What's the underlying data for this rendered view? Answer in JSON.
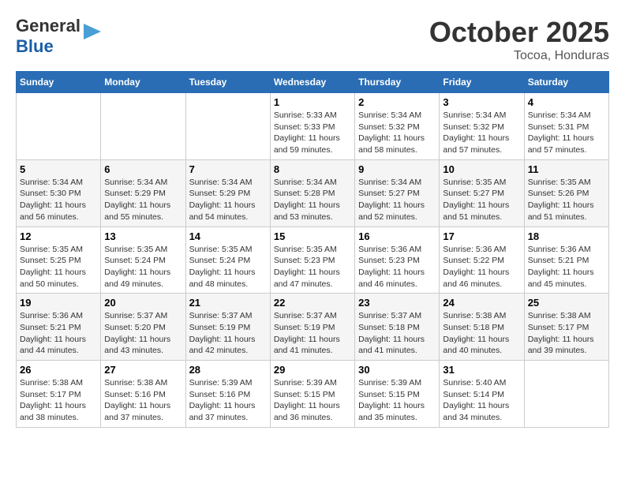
{
  "logo": {
    "line1": "General",
    "line2": "Blue"
  },
  "title": "October 2025",
  "location": "Tocoa, Honduras",
  "weekdays": [
    "Sunday",
    "Monday",
    "Tuesday",
    "Wednesday",
    "Thursday",
    "Friday",
    "Saturday"
  ],
  "weeks": [
    [
      {
        "day": "",
        "sunrise": "",
        "sunset": "",
        "daylight": ""
      },
      {
        "day": "",
        "sunrise": "",
        "sunset": "",
        "daylight": ""
      },
      {
        "day": "",
        "sunrise": "",
        "sunset": "",
        "daylight": ""
      },
      {
        "day": "1",
        "sunrise": "Sunrise: 5:33 AM",
        "sunset": "Sunset: 5:33 PM",
        "daylight": "Daylight: 11 hours and 59 minutes."
      },
      {
        "day": "2",
        "sunrise": "Sunrise: 5:34 AM",
        "sunset": "Sunset: 5:32 PM",
        "daylight": "Daylight: 11 hours and 58 minutes."
      },
      {
        "day": "3",
        "sunrise": "Sunrise: 5:34 AM",
        "sunset": "Sunset: 5:32 PM",
        "daylight": "Daylight: 11 hours and 57 minutes."
      },
      {
        "day": "4",
        "sunrise": "Sunrise: 5:34 AM",
        "sunset": "Sunset: 5:31 PM",
        "daylight": "Daylight: 11 hours and 57 minutes."
      }
    ],
    [
      {
        "day": "5",
        "sunrise": "Sunrise: 5:34 AM",
        "sunset": "Sunset: 5:30 PM",
        "daylight": "Daylight: 11 hours and 56 minutes."
      },
      {
        "day": "6",
        "sunrise": "Sunrise: 5:34 AM",
        "sunset": "Sunset: 5:29 PM",
        "daylight": "Daylight: 11 hours and 55 minutes."
      },
      {
        "day": "7",
        "sunrise": "Sunrise: 5:34 AM",
        "sunset": "Sunset: 5:29 PM",
        "daylight": "Daylight: 11 hours and 54 minutes."
      },
      {
        "day": "8",
        "sunrise": "Sunrise: 5:34 AM",
        "sunset": "Sunset: 5:28 PM",
        "daylight": "Daylight: 11 hours and 53 minutes."
      },
      {
        "day": "9",
        "sunrise": "Sunrise: 5:34 AM",
        "sunset": "Sunset: 5:27 PM",
        "daylight": "Daylight: 11 hours and 52 minutes."
      },
      {
        "day": "10",
        "sunrise": "Sunrise: 5:35 AM",
        "sunset": "Sunset: 5:27 PM",
        "daylight": "Daylight: 11 hours and 51 minutes."
      },
      {
        "day": "11",
        "sunrise": "Sunrise: 5:35 AM",
        "sunset": "Sunset: 5:26 PM",
        "daylight": "Daylight: 11 hours and 51 minutes."
      }
    ],
    [
      {
        "day": "12",
        "sunrise": "Sunrise: 5:35 AM",
        "sunset": "Sunset: 5:25 PM",
        "daylight": "Daylight: 11 hours and 50 minutes."
      },
      {
        "day": "13",
        "sunrise": "Sunrise: 5:35 AM",
        "sunset": "Sunset: 5:24 PM",
        "daylight": "Daylight: 11 hours and 49 minutes."
      },
      {
        "day": "14",
        "sunrise": "Sunrise: 5:35 AM",
        "sunset": "Sunset: 5:24 PM",
        "daylight": "Daylight: 11 hours and 48 minutes."
      },
      {
        "day": "15",
        "sunrise": "Sunrise: 5:35 AM",
        "sunset": "Sunset: 5:23 PM",
        "daylight": "Daylight: 11 hours and 47 minutes."
      },
      {
        "day": "16",
        "sunrise": "Sunrise: 5:36 AM",
        "sunset": "Sunset: 5:23 PM",
        "daylight": "Daylight: 11 hours and 46 minutes."
      },
      {
        "day": "17",
        "sunrise": "Sunrise: 5:36 AM",
        "sunset": "Sunset: 5:22 PM",
        "daylight": "Daylight: 11 hours and 46 minutes."
      },
      {
        "day": "18",
        "sunrise": "Sunrise: 5:36 AM",
        "sunset": "Sunset: 5:21 PM",
        "daylight": "Daylight: 11 hours and 45 minutes."
      }
    ],
    [
      {
        "day": "19",
        "sunrise": "Sunrise: 5:36 AM",
        "sunset": "Sunset: 5:21 PM",
        "daylight": "Daylight: 11 hours and 44 minutes."
      },
      {
        "day": "20",
        "sunrise": "Sunrise: 5:37 AM",
        "sunset": "Sunset: 5:20 PM",
        "daylight": "Daylight: 11 hours and 43 minutes."
      },
      {
        "day": "21",
        "sunrise": "Sunrise: 5:37 AM",
        "sunset": "Sunset: 5:19 PM",
        "daylight": "Daylight: 11 hours and 42 minutes."
      },
      {
        "day": "22",
        "sunrise": "Sunrise: 5:37 AM",
        "sunset": "Sunset: 5:19 PM",
        "daylight": "Daylight: 11 hours and 41 minutes."
      },
      {
        "day": "23",
        "sunrise": "Sunrise: 5:37 AM",
        "sunset": "Sunset: 5:18 PM",
        "daylight": "Daylight: 11 hours and 41 minutes."
      },
      {
        "day": "24",
        "sunrise": "Sunrise: 5:38 AM",
        "sunset": "Sunset: 5:18 PM",
        "daylight": "Daylight: 11 hours and 40 minutes."
      },
      {
        "day": "25",
        "sunrise": "Sunrise: 5:38 AM",
        "sunset": "Sunset: 5:17 PM",
        "daylight": "Daylight: 11 hours and 39 minutes."
      }
    ],
    [
      {
        "day": "26",
        "sunrise": "Sunrise: 5:38 AM",
        "sunset": "Sunset: 5:17 PM",
        "daylight": "Daylight: 11 hours and 38 minutes."
      },
      {
        "day": "27",
        "sunrise": "Sunrise: 5:38 AM",
        "sunset": "Sunset: 5:16 PM",
        "daylight": "Daylight: 11 hours and 37 minutes."
      },
      {
        "day": "28",
        "sunrise": "Sunrise: 5:39 AM",
        "sunset": "Sunset: 5:16 PM",
        "daylight": "Daylight: 11 hours and 37 minutes."
      },
      {
        "day": "29",
        "sunrise": "Sunrise: 5:39 AM",
        "sunset": "Sunset: 5:15 PM",
        "daylight": "Daylight: 11 hours and 36 minutes."
      },
      {
        "day": "30",
        "sunrise": "Sunrise: 5:39 AM",
        "sunset": "Sunset: 5:15 PM",
        "daylight": "Daylight: 11 hours and 35 minutes."
      },
      {
        "day": "31",
        "sunrise": "Sunrise: 5:40 AM",
        "sunset": "Sunset: 5:14 PM",
        "daylight": "Daylight: 11 hours and 34 minutes."
      },
      {
        "day": "",
        "sunrise": "",
        "sunset": "",
        "daylight": ""
      }
    ]
  ]
}
